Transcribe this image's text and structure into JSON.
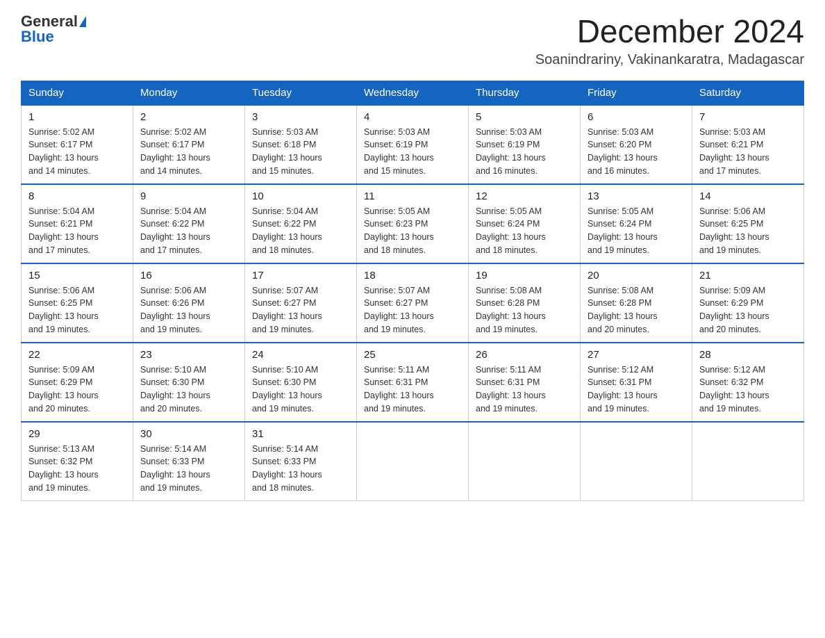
{
  "logo": {
    "general": "General",
    "blue": "Blue"
  },
  "title": "December 2024",
  "location": "Soanindrariny, Vakinankaratra, Madagascar",
  "weekdays": [
    "Sunday",
    "Monday",
    "Tuesday",
    "Wednesday",
    "Thursday",
    "Friday",
    "Saturday"
  ],
  "rows": [
    [
      {
        "day": "1",
        "sunrise": "5:02 AM",
        "sunset": "6:17 PM",
        "daylight": "13 hours and 14 minutes."
      },
      {
        "day": "2",
        "sunrise": "5:02 AM",
        "sunset": "6:17 PM",
        "daylight": "13 hours and 14 minutes."
      },
      {
        "day": "3",
        "sunrise": "5:03 AM",
        "sunset": "6:18 PM",
        "daylight": "13 hours and 15 minutes."
      },
      {
        "day": "4",
        "sunrise": "5:03 AM",
        "sunset": "6:19 PM",
        "daylight": "13 hours and 15 minutes."
      },
      {
        "day": "5",
        "sunrise": "5:03 AM",
        "sunset": "6:19 PM",
        "daylight": "13 hours and 16 minutes."
      },
      {
        "day": "6",
        "sunrise": "5:03 AM",
        "sunset": "6:20 PM",
        "daylight": "13 hours and 16 minutes."
      },
      {
        "day": "7",
        "sunrise": "5:03 AM",
        "sunset": "6:21 PM",
        "daylight": "13 hours and 17 minutes."
      }
    ],
    [
      {
        "day": "8",
        "sunrise": "5:04 AM",
        "sunset": "6:21 PM",
        "daylight": "13 hours and 17 minutes."
      },
      {
        "day": "9",
        "sunrise": "5:04 AM",
        "sunset": "6:22 PM",
        "daylight": "13 hours and 17 minutes."
      },
      {
        "day": "10",
        "sunrise": "5:04 AM",
        "sunset": "6:22 PM",
        "daylight": "13 hours and 18 minutes."
      },
      {
        "day": "11",
        "sunrise": "5:05 AM",
        "sunset": "6:23 PM",
        "daylight": "13 hours and 18 minutes."
      },
      {
        "day": "12",
        "sunrise": "5:05 AM",
        "sunset": "6:24 PM",
        "daylight": "13 hours and 18 minutes."
      },
      {
        "day": "13",
        "sunrise": "5:05 AM",
        "sunset": "6:24 PM",
        "daylight": "13 hours and 19 minutes."
      },
      {
        "day": "14",
        "sunrise": "5:06 AM",
        "sunset": "6:25 PM",
        "daylight": "13 hours and 19 minutes."
      }
    ],
    [
      {
        "day": "15",
        "sunrise": "5:06 AM",
        "sunset": "6:25 PM",
        "daylight": "13 hours and 19 minutes."
      },
      {
        "day": "16",
        "sunrise": "5:06 AM",
        "sunset": "6:26 PM",
        "daylight": "13 hours and 19 minutes."
      },
      {
        "day": "17",
        "sunrise": "5:07 AM",
        "sunset": "6:27 PM",
        "daylight": "13 hours and 19 minutes."
      },
      {
        "day": "18",
        "sunrise": "5:07 AM",
        "sunset": "6:27 PM",
        "daylight": "13 hours and 19 minutes."
      },
      {
        "day": "19",
        "sunrise": "5:08 AM",
        "sunset": "6:28 PM",
        "daylight": "13 hours and 19 minutes."
      },
      {
        "day": "20",
        "sunrise": "5:08 AM",
        "sunset": "6:28 PM",
        "daylight": "13 hours and 20 minutes."
      },
      {
        "day": "21",
        "sunrise": "5:09 AM",
        "sunset": "6:29 PM",
        "daylight": "13 hours and 20 minutes."
      }
    ],
    [
      {
        "day": "22",
        "sunrise": "5:09 AM",
        "sunset": "6:29 PM",
        "daylight": "13 hours and 20 minutes."
      },
      {
        "day": "23",
        "sunrise": "5:10 AM",
        "sunset": "6:30 PM",
        "daylight": "13 hours and 20 minutes."
      },
      {
        "day": "24",
        "sunrise": "5:10 AM",
        "sunset": "6:30 PM",
        "daylight": "13 hours and 19 minutes."
      },
      {
        "day": "25",
        "sunrise": "5:11 AM",
        "sunset": "6:31 PM",
        "daylight": "13 hours and 19 minutes."
      },
      {
        "day": "26",
        "sunrise": "5:11 AM",
        "sunset": "6:31 PM",
        "daylight": "13 hours and 19 minutes."
      },
      {
        "day": "27",
        "sunrise": "5:12 AM",
        "sunset": "6:31 PM",
        "daylight": "13 hours and 19 minutes."
      },
      {
        "day": "28",
        "sunrise": "5:12 AM",
        "sunset": "6:32 PM",
        "daylight": "13 hours and 19 minutes."
      }
    ],
    [
      {
        "day": "29",
        "sunrise": "5:13 AM",
        "sunset": "6:32 PM",
        "daylight": "13 hours and 19 minutes."
      },
      {
        "day": "30",
        "sunrise": "5:14 AM",
        "sunset": "6:33 PM",
        "daylight": "13 hours and 19 minutes."
      },
      {
        "day": "31",
        "sunrise": "5:14 AM",
        "sunset": "6:33 PM",
        "daylight": "13 hours and 18 minutes."
      },
      null,
      null,
      null,
      null
    ]
  ],
  "labels": {
    "sunrise": "Sunrise:",
    "sunset": "Sunset:",
    "daylight": "Daylight:"
  }
}
